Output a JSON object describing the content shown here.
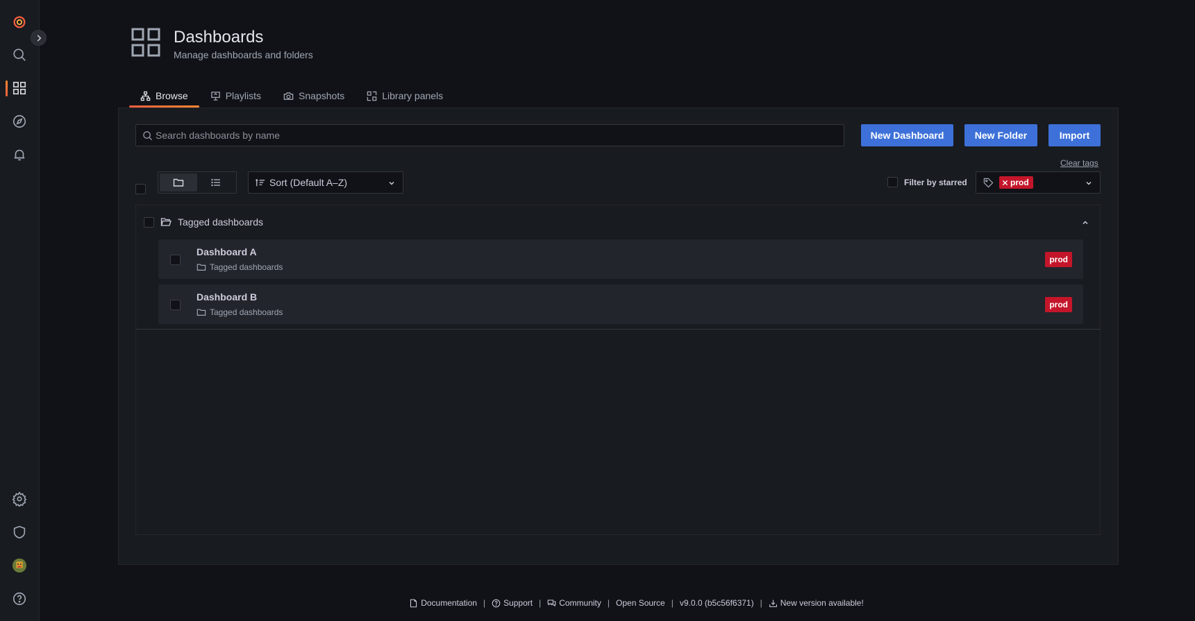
{
  "page": {
    "title": "Dashboards",
    "subtitle": "Manage dashboards and folders"
  },
  "sidebar": {
    "items": [
      {
        "icon": "grafana-logo-icon"
      },
      {
        "icon": "search-icon"
      },
      {
        "icon": "dashboards-icon",
        "active": true
      },
      {
        "icon": "explore-icon"
      },
      {
        "icon": "alerting-icon"
      },
      {
        "icon": "gear-icon"
      },
      {
        "icon": "shield-icon"
      },
      {
        "icon": "avatar"
      },
      {
        "icon": "help-icon"
      }
    ]
  },
  "tabs": [
    {
      "label": "Browse",
      "icon": "sitemap-icon",
      "active": true
    },
    {
      "label": "Playlists",
      "icon": "presentation-icon"
    },
    {
      "label": "Snapshots",
      "icon": "camera-icon"
    },
    {
      "label": "Library panels",
      "icon": "library-panel-icon"
    }
  ],
  "toolbar": {
    "search_placeholder": "Search dashboards by name",
    "new_dashboard": "New Dashboard",
    "new_folder": "New Folder",
    "import": "Import",
    "clear_tags": "Clear tags",
    "sort_label": "Sort (Default A–Z)",
    "filter_starred": "Filter by starred",
    "selected_tag": "prod"
  },
  "section": {
    "title": "Tagged dashboards",
    "rows": [
      {
        "title": "Dashboard A",
        "folder": "Tagged dashboards",
        "tag": "prod"
      },
      {
        "title": "Dashboard B",
        "folder": "Tagged dashboards",
        "tag": "prod"
      }
    ]
  },
  "footer": {
    "documentation": "Documentation",
    "support": "Support",
    "community": "Community",
    "open_source": "Open Source",
    "version": "v9.0.0 (b5c56f6371)",
    "new_version": "New version available!"
  },
  "colors": {
    "primary_button": "#3d71d9",
    "tag_red": "#c4162a",
    "accent_orange": "#ff8833",
    "background": "#111217"
  }
}
